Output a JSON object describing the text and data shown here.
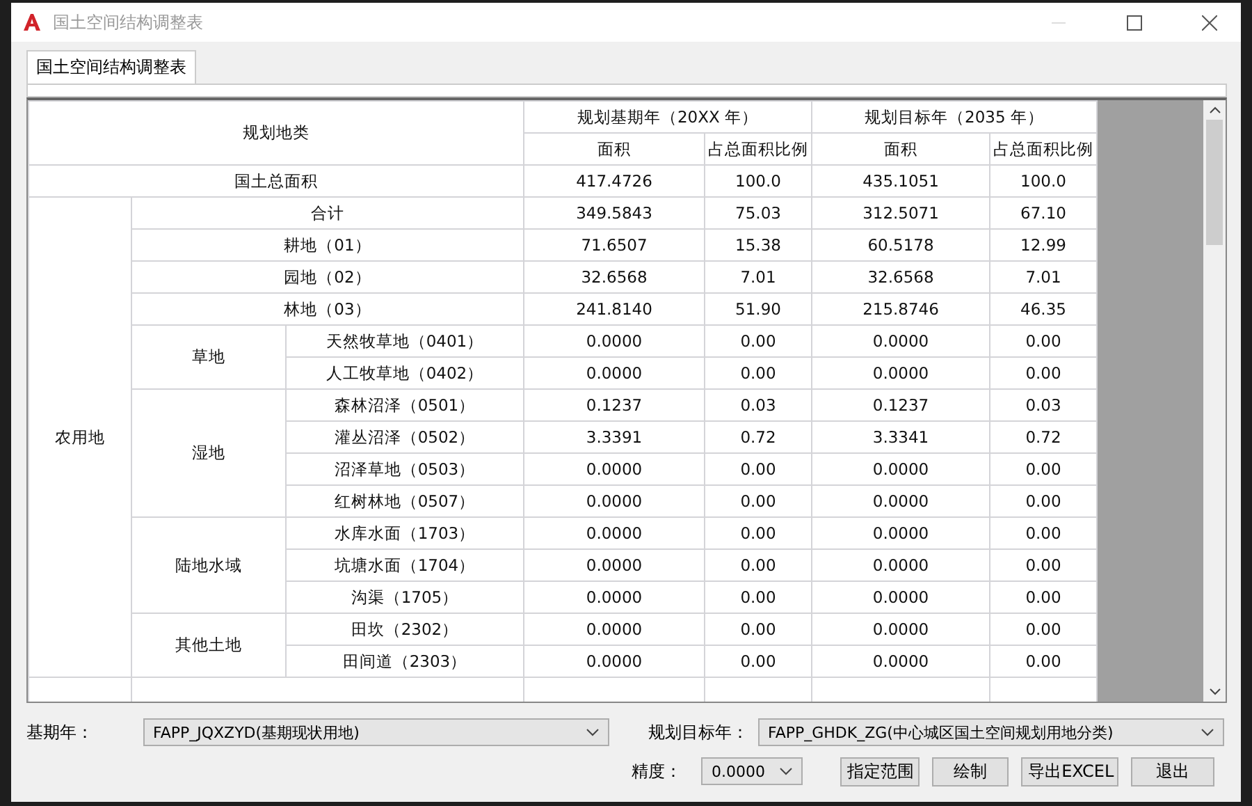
{
  "window": {
    "title": "国土空间结构调整表"
  },
  "tabs": [
    {
      "label": "国土空间结构调整表",
      "selected": true
    }
  ],
  "table": {
    "header": {
      "category": "规划地类",
      "base_year": "规划基期年（20XX 年）",
      "target_year": "规划目标年（2035 年）",
      "sub_columns": [
        "面积",
        "占总面积比例",
        "面积",
        "占总面积比例"
      ]
    },
    "total_row": {
      "label": "国土总面积",
      "values": [
        "417.4726",
        "100.0",
        "435.1051",
        "100.0"
      ]
    },
    "groups": [
      {
        "label": "农用地",
        "rows": [
          {
            "label": "合计",
            "values": [
              "349.5843",
              "75.03",
              "312.5071",
              "67.10"
            ]
          },
          {
            "label": "耕地（01）",
            "values": [
              "71.6507",
              "15.38",
              "60.5178",
              "12.99"
            ]
          },
          {
            "label": "园地（02）",
            "values": [
              "32.6568",
              "7.01",
              "32.6568",
              "7.01"
            ]
          },
          {
            "label": "林地（03）",
            "values": [
              "241.8140",
              "51.90",
              "215.8746",
              "46.35"
            ]
          },
          {
            "label": "草地",
            "children": [
              {
                "label": "天然牧草地（0401）",
                "values": [
                  "0.0000",
                  "0.00",
                  "0.0000",
                  "0.00"
                ]
              },
              {
                "label": "人工牧草地（0402）",
                "values": [
                  "0.0000",
                  "0.00",
                  "0.0000",
                  "0.00"
                ]
              }
            ]
          },
          {
            "label": "湿地",
            "children": [
              {
                "label": "森林沼泽（0501）",
                "values": [
                  "0.1237",
                  "0.03",
                  "0.1237",
                  "0.03"
                ]
              },
              {
                "label": "灌丛沼泽（0502）",
                "values": [
                  "3.3391",
                  "0.72",
                  "3.3341",
                  "0.72"
                ]
              },
              {
                "label": "沼泽草地（0503）",
                "values": [
                  "0.0000",
                  "0.00",
                  "0.0000",
                  "0.00"
                ]
              },
              {
                "label": "红树林地（0507）",
                "values": [
                  "0.0000",
                  "0.00",
                  "0.0000",
                  "0.00"
                ]
              }
            ]
          },
          {
            "label": "陆地水域",
            "children": [
              {
                "label": "水库水面（1703）",
                "values": [
                  "0.0000",
                  "0.00",
                  "0.0000",
                  "0.00"
                ]
              },
              {
                "label": "坑塘水面（1704）",
                "values": [
                  "0.0000",
                  "0.00",
                  "0.0000",
                  "0.00"
                ]
              },
              {
                "label": "沟渠（1705）",
                "values": [
                  "0.0000",
                  "0.00",
                  "0.0000",
                  "0.00"
                ]
              }
            ]
          },
          {
            "label": "其他土地",
            "children": [
              {
                "label": "田坎（2302）",
                "values": [
                  "0.0000",
                  "0.00",
                  "0.0000",
                  "0.00"
                ]
              },
              {
                "label": "田间道（2303）",
                "values": [
                  "0.0000",
                  "0.00",
                  "0.0000",
                  "0.00"
                ]
              }
            ]
          }
        ]
      }
    ]
  },
  "base_year": {
    "label": "基期年：",
    "value": "FAPP_JQXZYD(基期现状用地)"
  },
  "target_year": {
    "label": "规划目标年：",
    "value": "FAPP_GHDK_ZG(中心城区国土空间规划用地分类)"
  },
  "precision": {
    "label": "精度：",
    "value": "0.0000"
  },
  "buttons": [
    "指定范围",
    "绘制",
    "导出EXCEL",
    "退出"
  ]
}
